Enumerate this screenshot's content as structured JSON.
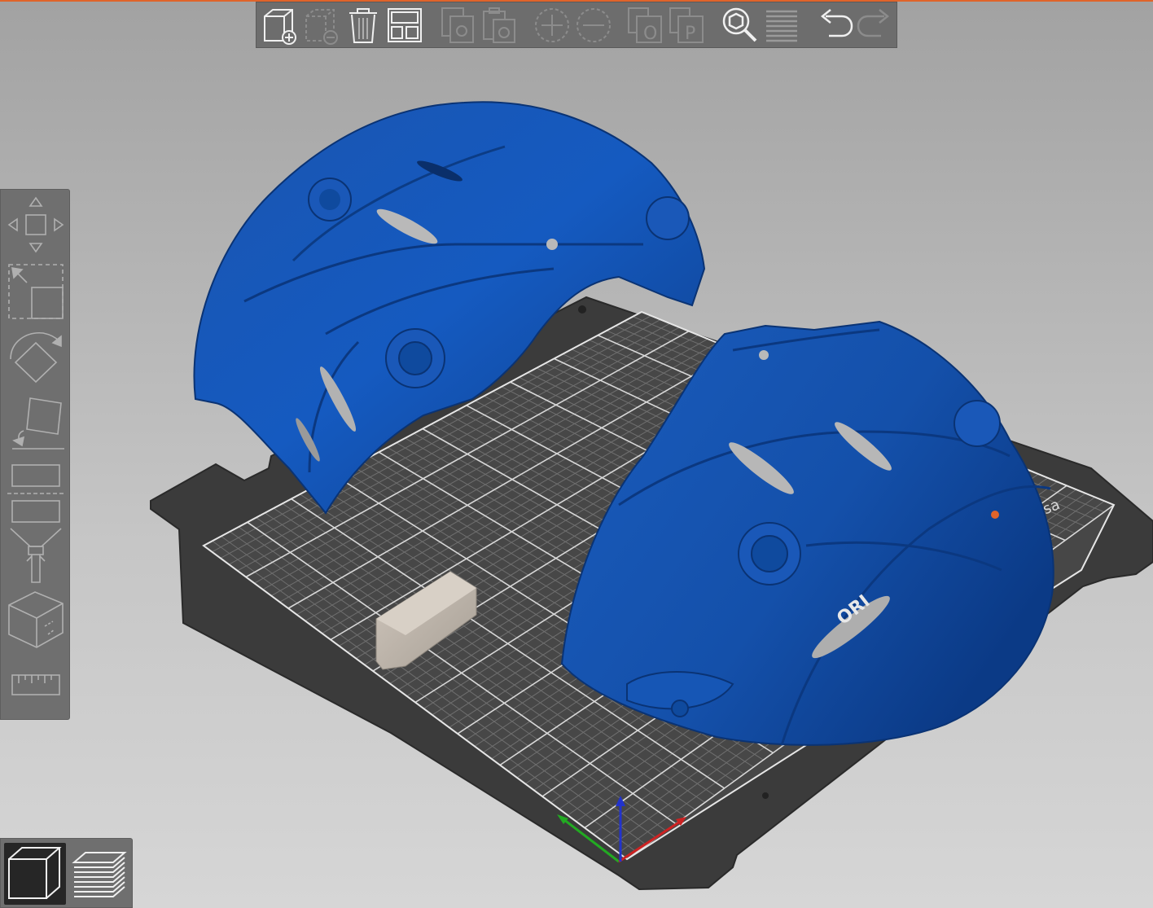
{
  "app": {
    "accent_color": "#e0642a"
  },
  "top_toolbar": {
    "buttons": [
      {
        "id": "add",
        "icon": "add-object-icon",
        "enabled": true
      },
      {
        "id": "delete",
        "icon": "delete-object-icon",
        "enabled": false
      },
      {
        "id": "delete-all",
        "icon": "delete-all-icon",
        "enabled": true
      },
      {
        "id": "arrange",
        "icon": "arrange-icon",
        "enabled": true
      },
      {
        "id": "copy",
        "icon": "copy-icon",
        "enabled": false
      },
      {
        "id": "paste",
        "icon": "paste-icon",
        "enabled": false
      },
      {
        "id": "add-instance",
        "icon": "add-instance-icon",
        "enabled": false
      },
      {
        "id": "remove-instance",
        "icon": "remove-instance-icon",
        "enabled": false
      },
      {
        "id": "split-objects",
        "icon": "split-objects-icon",
        "glyph": "O",
        "enabled": false
      },
      {
        "id": "split-parts",
        "icon": "split-parts-icon",
        "glyph": "P",
        "enabled": false
      },
      {
        "id": "search",
        "icon": "search-icon",
        "enabled": true
      },
      {
        "id": "layers-editing",
        "icon": "layers-editing-icon",
        "enabled": true
      },
      {
        "id": "undo",
        "icon": "undo-icon",
        "enabled": true
      },
      {
        "id": "redo",
        "icon": "redo-icon",
        "enabled": false
      }
    ]
  },
  "left_toolbar": {
    "tools": [
      {
        "id": "move",
        "icon": "move-icon"
      },
      {
        "id": "scale",
        "icon": "scale-icon"
      },
      {
        "id": "rotate",
        "icon": "rotate-icon"
      },
      {
        "id": "place-on-face",
        "icon": "place-on-face-icon"
      },
      {
        "id": "cut",
        "icon": "cut-icon"
      },
      {
        "id": "paint-supports",
        "icon": "paint-supports-icon"
      },
      {
        "id": "seam-painting",
        "icon": "seam-painting-icon"
      },
      {
        "id": "measure",
        "icon": "measure-icon"
      }
    ]
  },
  "view_switcher": {
    "views": [
      {
        "id": "3d-view",
        "icon": "cube-view-icon",
        "active": true
      },
      {
        "id": "preview",
        "icon": "layers-preview-icon",
        "active": false
      }
    ]
  },
  "scene": {
    "model_color": "#1e5cb8",
    "bed_color": "#3a3a3a",
    "bed_logo_text": ".usa",
    "model_label_text": "ORI"
  }
}
